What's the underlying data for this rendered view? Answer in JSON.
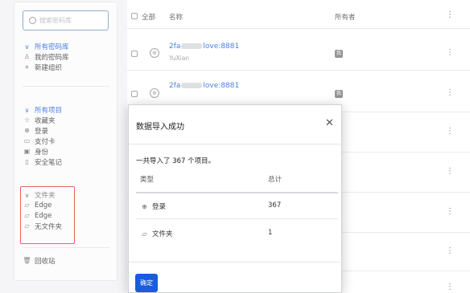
{
  "sidebar": {
    "search_placeholder": "搜索密码库",
    "vaults": {
      "header": "所有密码库",
      "items": [
        {
          "icon": "user-icon",
          "glyph": "♙",
          "label": "我的密码库"
        },
        {
          "icon": "plus-icon",
          "glyph": "+",
          "label": "新建组织"
        }
      ]
    },
    "items_section": {
      "header": "所有项目",
      "items": [
        {
          "icon": "star-icon",
          "glyph": "☆",
          "label": "收藏夹"
        },
        {
          "icon": "globe-icon",
          "glyph": "⊕",
          "label": "登录"
        },
        {
          "icon": "card-icon",
          "glyph": "▭",
          "label": "支付卡"
        },
        {
          "icon": "id-card-icon",
          "glyph": "▣",
          "label": "身份"
        },
        {
          "icon": "note-icon",
          "glyph": "▯",
          "label": "安全笔记"
        }
      ]
    },
    "folders": {
      "header": "文件夹",
      "items": [
        {
          "icon": "folder-icon",
          "glyph": "▱",
          "label": "Edge"
        },
        {
          "icon": "folder-icon",
          "glyph": "▱",
          "label": "Edge"
        },
        {
          "icon": "folder-icon",
          "glyph": "▱",
          "label": "无文件夹"
        }
      ]
    },
    "trash": {
      "icon": "trash-icon",
      "glyph": "🗑",
      "label": "回收站"
    }
  },
  "list": {
    "columns": {
      "all": "全部",
      "name": "名称",
      "owner": "所有者"
    },
    "rows": [
      {
        "name_prefix": "2fa",
        "name_suffix": "love:8881",
        "subtitle": "YuXian",
        "owner_badge": "我"
      },
      {
        "name_prefix": "2fa",
        "name_suffix": "love:8881",
        "subtitle": "",
        "owner_badge": "我"
      }
    ]
  },
  "modal": {
    "title": "数据导入成功",
    "message": "一共导入了 367 个项目。",
    "col_type": "类型",
    "col_total": "总计",
    "rows": [
      {
        "icon": "globe-icon",
        "glyph": "⊕",
        "type": "登录",
        "total": "367"
      },
      {
        "icon": "folder-icon",
        "glyph": "▱",
        "type": "文件夹",
        "total": "1"
      }
    ],
    "confirm": "确定"
  }
}
